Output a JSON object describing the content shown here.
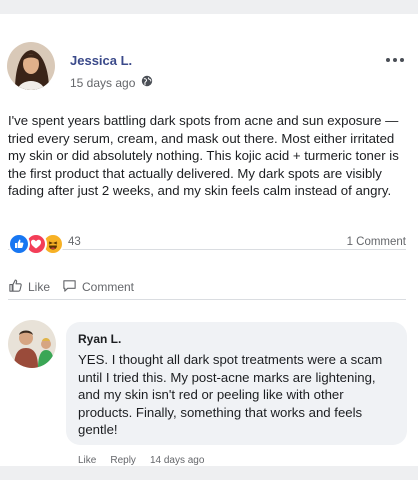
{
  "post": {
    "author": "Jessica L.",
    "time": "15 days ago",
    "audience_icon": "globe-icon",
    "text": "I've spent years battling dark spots from acne and sun exposure — tried every serum, cream, and mask out there. Most either irritated my skin or did absolutely nothing. This kojic acid + turmeric toner is the first product that actually delivered. My dark spots are visibly fading after just 2 weeks, and my skin feels calm instead of angry.",
    "reactions": [
      "like",
      "love",
      "haha"
    ],
    "reaction_count": "43",
    "comment_count": "1 Comment"
  },
  "actions": {
    "like": "Like",
    "comment": "Comment"
  },
  "reply": {
    "author": "Ryan L.",
    "text": "YES. I thought all dark spot treatments were a scam until I tried this. My post-acne marks are lightening, and my skin isn't red or peeling like with other products. Finally, something that works and feels gentle!",
    "like": "Like",
    "reply": "Reply",
    "time": "14 days ago"
  },
  "colors": {
    "author_name": "#3b4a8a",
    "like_blue": "#1877f2",
    "love_red": "#f33e58",
    "haha_yellow": "#f7b125"
  }
}
